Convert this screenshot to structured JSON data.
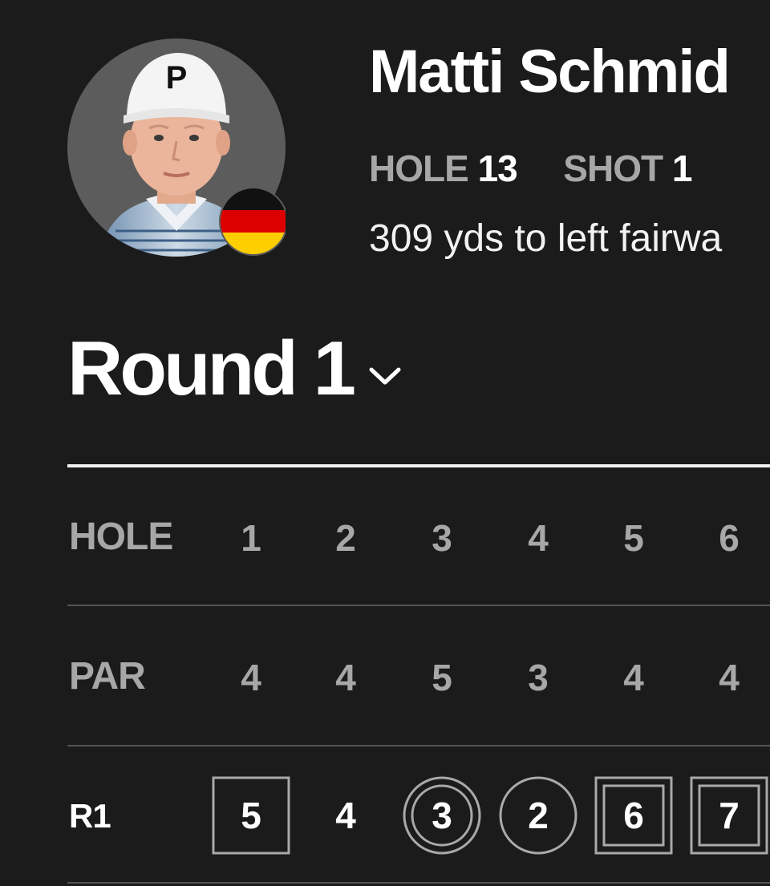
{
  "player": {
    "name": "Matti Schmid",
    "country_flag": "germany-flag",
    "cap_letter": "P"
  },
  "shot": {
    "hole_label": "HOLE",
    "hole_value": "13",
    "shot_label": "SHOT",
    "shot_value": "1",
    "description": "309 yds to left fairwa"
  },
  "round": {
    "title": "Round 1",
    "chevron_icon": "chevron-down-icon"
  },
  "scorecard": {
    "hole_label": "HOLE",
    "par_label": "PAR",
    "round_label": "R1",
    "holes": [
      "1",
      "2",
      "3",
      "4",
      "5",
      "6"
    ],
    "pars": [
      "4",
      "4",
      "5",
      "3",
      "4",
      "4"
    ],
    "scores": [
      {
        "value": "5",
        "marker": "single-square"
      },
      {
        "value": "4",
        "marker": "none"
      },
      {
        "value": "3",
        "marker": "double-circle"
      },
      {
        "value": "2",
        "marker": "single-circle"
      },
      {
        "value": "6",
        "marker": "double-square"
      },
      {
        "value": "7",
        "marker": "double-square"
      }
    ]
  },
  "colors": {
    "background": "#1b1b1b",
    "text_primary": "#ffffff",
    "text_muted": "#a7a7a7",
    "divider": "#555555",
    "flag_black": "#111111",
    "flag_red": "#dd0000",
    "flag_gold": "#ffce00"
  }
}
